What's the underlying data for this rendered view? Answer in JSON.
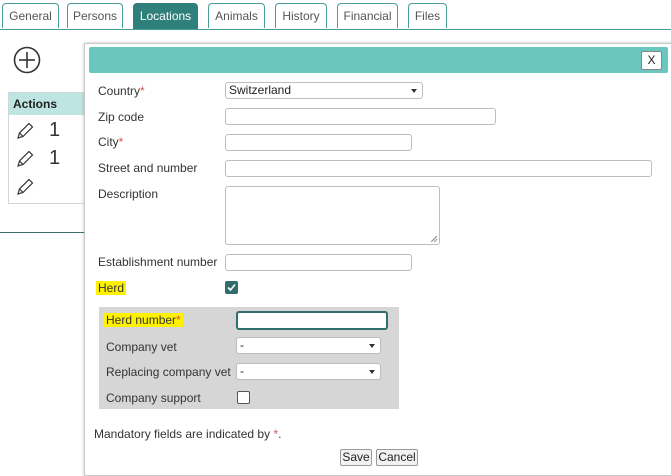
{
  "tabs": [
    {
      "label": "General"
    },
    {
      "label": "Persons"
    },
    {
      "label": "Locations"
    },
    {
      "label": "Animals"
    },
    {
      "label": "History"
    },
    {
      "label": "Financial"
    },
    {
      "label": "Files"
    }
  ],
  "active_tab": "Locations",
  "background": {
    "table_header": "Actions",
    "rows": [
      {
        "value": "1"
      },
      {
        "value": "1"
      }
    ]
  },
  "dialog": {
    "close_label": "X",
    "fields": {
      "country": {
        "label": "Country",
        "required_mark": "*",
        "value": "Switzerland"
      },
      "zip": {
        "label": "Zip code",
        "value": ""
      },
      "city": {
        "label": "City",
        "required_mark": "*",
        "value": ""
      },
      "street": {
        "label": "Street and number",
        "value": ""
      },
      "description": {
        "label": "Description",
        "value": ""
      },
      "establishment": {
        "label": "Establishment number",
        "value": ""
      },
      "herd": {
        "label": "Herd",
        "checked": true
      }
    },
    "herd_section": {
      "herd_number": {
        "label": "Herd number",
        "required_mark": "*",
        "value": ""
      },
      "company_vet": {
        "label": "Company vet",
        "value": "-"
      },
      "replacing_vet": {
        "label": "Replacing company vet",
        "value": "-"
      },
      "company_support": {
        "label": "Company support",
        "checked": false
      }
    },
    "mandatory_note": "Mandatory fields are indicated by ",
    "mandatory_mark": "*",
    "mandatory_end": ".",
    "save_label": "Save",
    "cancel_label": "Cancel"
  },
  "colors": {
    "accent": "#2f7f7b",
    "titlebar": "#69c7bf",
    "highlight": "#fff200",
    "required": "#d9534f"
  }
}
